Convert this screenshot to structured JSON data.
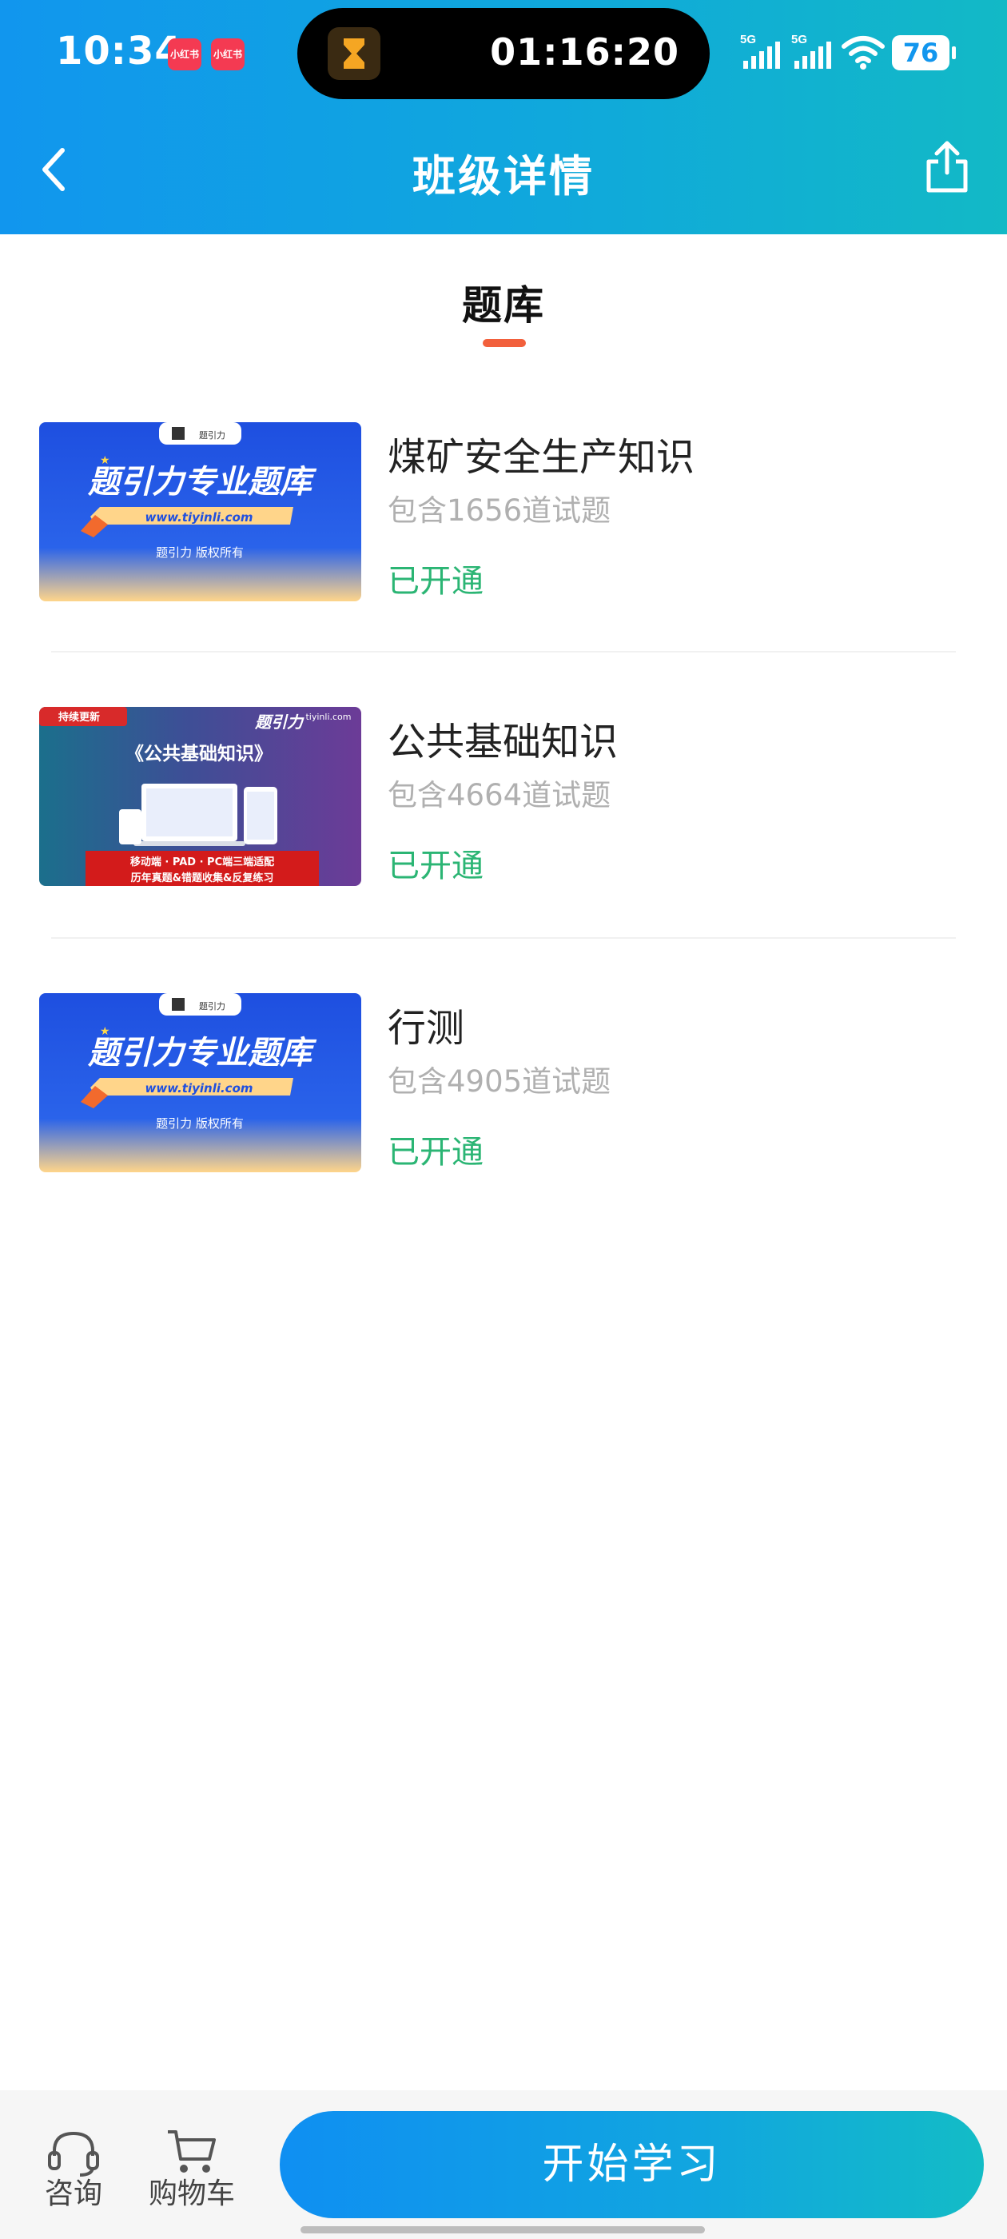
{
  "status_bar": {
    "time": "10:34",
    "app_badges": [
      "小红书",
      "小红书"
    ],
    "timer": "01:16:20",
    "network": [
      "5G",
      "5G"
    ],
    "battery": "76"
  },
  "nav": {
    "title": "班级详情",
    "back_icon": "chevron-left-icon",
    "share_icon": "share-icon"
  },
  "tab": {
    "label": "题库",
    "accent_color": "#f2603c"
  },
  "banks": [
    {
      "title": "煤矿安全生产知识",
      "count": "包含1656道试题",
      "status": "已开通",
      "thumb": {
        "logo_name": "题引力",
        "headline": "题引力专业题库",
        "url": "www.tiyinli.com",
        "footer": "题引力 版权所有"
      }
    },
    {
      "title": "公共基础知识",
      "count": "包含4664道试题",
      "status": "已开通",
      "thumb": {
        "tag": "持续更新",
        "brand": "题引力",
        "site": "tiyinli.com",
        "headline": "《公共基础知识》",
        "line1": "移动端 · PAD · PC端三端适配",
        "line2": "历年真题&错题收集&反复练习"
      }
    },
    {
      "title": "行测",
      "count": "包含4905道试题",
      "status": "已开通",
      "thumb": {
        "logo_name": "题引力",
        "headline": "题引力专业题库",
        "url": "www.tiyinli.com",
        "footer": "题引力 版权所有"
      }
    }
  ],
  "bottom_bar": {
    "consult_label": "咨询",
    "cart_label": "购物车",
    "cta_label": "开始学习"
  },
  "colors": {
    "header_start": "#1196ee",
    "header_end": "#12b9c6",
    "status_green": "#2bb574",
    "muted_text": "#b0b0b0"
  }
}
